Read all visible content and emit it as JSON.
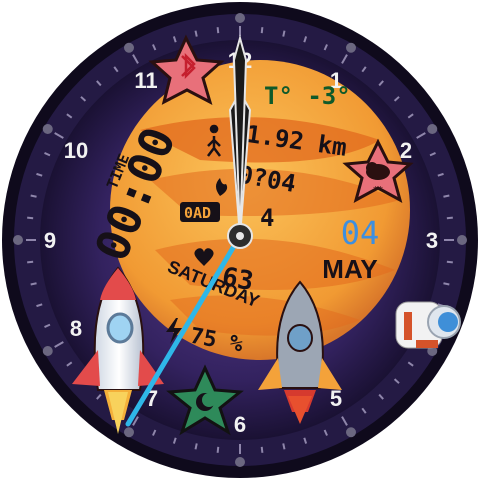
{
  "watch": {
    "hour_numerals": [
      "12",
      "1",
      "2",
      "3",
      "4",
      "5",
      "6",
      "7",
      "8",
      "9",
      "10",
      "11"
    ],
    "time_label": "TIME",
    "digital_time": "00:00",
    "temperature": "T° -3°",
    "distance": "1.92 km",
    "steps_value": "0?04",
    "calories_value": "0AD",
    "calories_value_2": "4",
    "heart_rate": "63",
    "weekday": "SATURDAY",
    "battery": "75 %",
    "day": "04",
    "month": "MAY"
  },
  "icons": {
    "bluetooth": "bluetooth-icon",
    "weather": "cloud-snow-icon",
    "walk": "walking-person-icon",
    "fire": "flame-icon",
    "heart": "heart-icon",
    "battery": "lightning-icon",
    "moon": "moon-phase-icon",
    "astronaut": "astronaut-icon",
    "rocket_left": "rocket-icon",
    "rocket_center": "rocket-icon"
  },
  "colors": {
    "bezel": "#0f0a1c",
    "dial_ring": "#2a1d4f",
    "dial_inner": "#3b2a6b",
    "planet": "#f4a23a",
    "planet_band": "#e0661f",
    "star_pink": "#e8707a",
    "star_green": "#2e8a5a",
    "date_blue": "#3d8fe0",
    "second_hand": "#2fb7e8",
    "text_dark": "#161018"
  }
}
